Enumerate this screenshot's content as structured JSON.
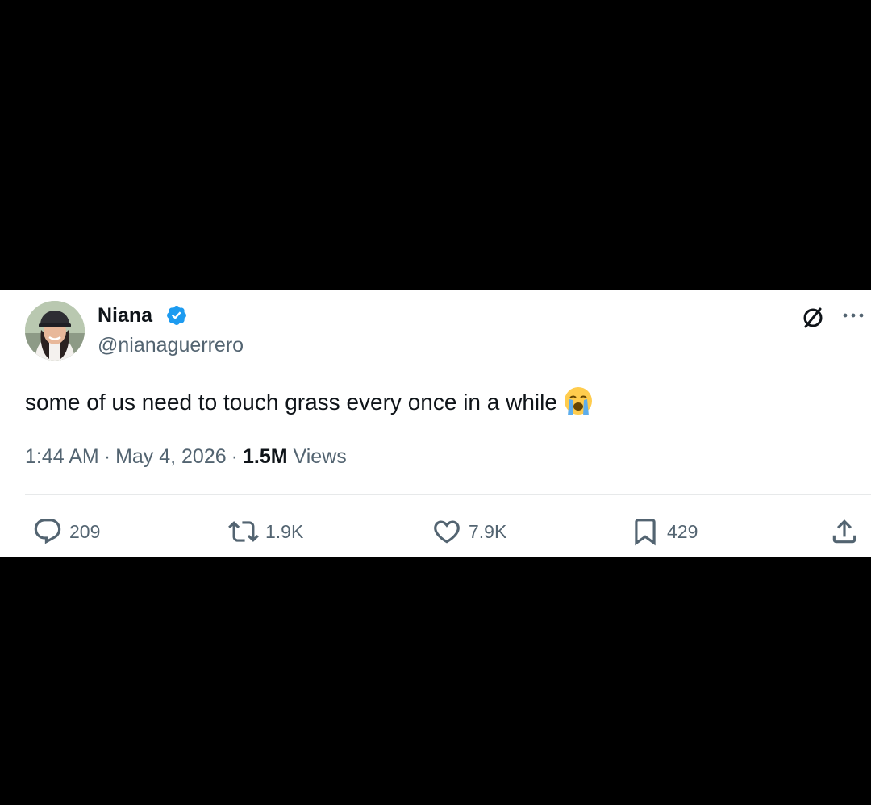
{
  "tweet": {
    "author": {
      "display_name": "Niana",
      "handle": "@nianaguerrero",
      "verified": true
    },
    "text": "some of us need to touch grass every once in a while",
    "emoji": "loudly-crying-face",
    "time": "1:44 AM",
    "date": "May 4, 2026",
    "views_count": "1.5M",
    "views_label": "Views",
    "separator": "·",
    "stats": {
      "replies": "209",
      "retweets": "1.9K",
      "likes": "7.9K",
      "bookmarks": "429"
    }
  },
  "icons": {
    "verified": "verified-badge-icon",
    "grok": "grok-icon",
    "more": "more-icon",
    "reply": "reply-icon",
    "retweet": "retweet-icon",
    "like": "heart-icon",
    "bookmark": "bookmark-icon",
    "share": "share-icon"
  },
  "colors": {
    "background": "#000000",
    "card": "#ffffff",
    "text_primary": "#0f1419",
    "text_secondary": "#536471",
    "verified_blue": "#1d9bf0",
    "divider": "#e7e9ea"
  }
}
